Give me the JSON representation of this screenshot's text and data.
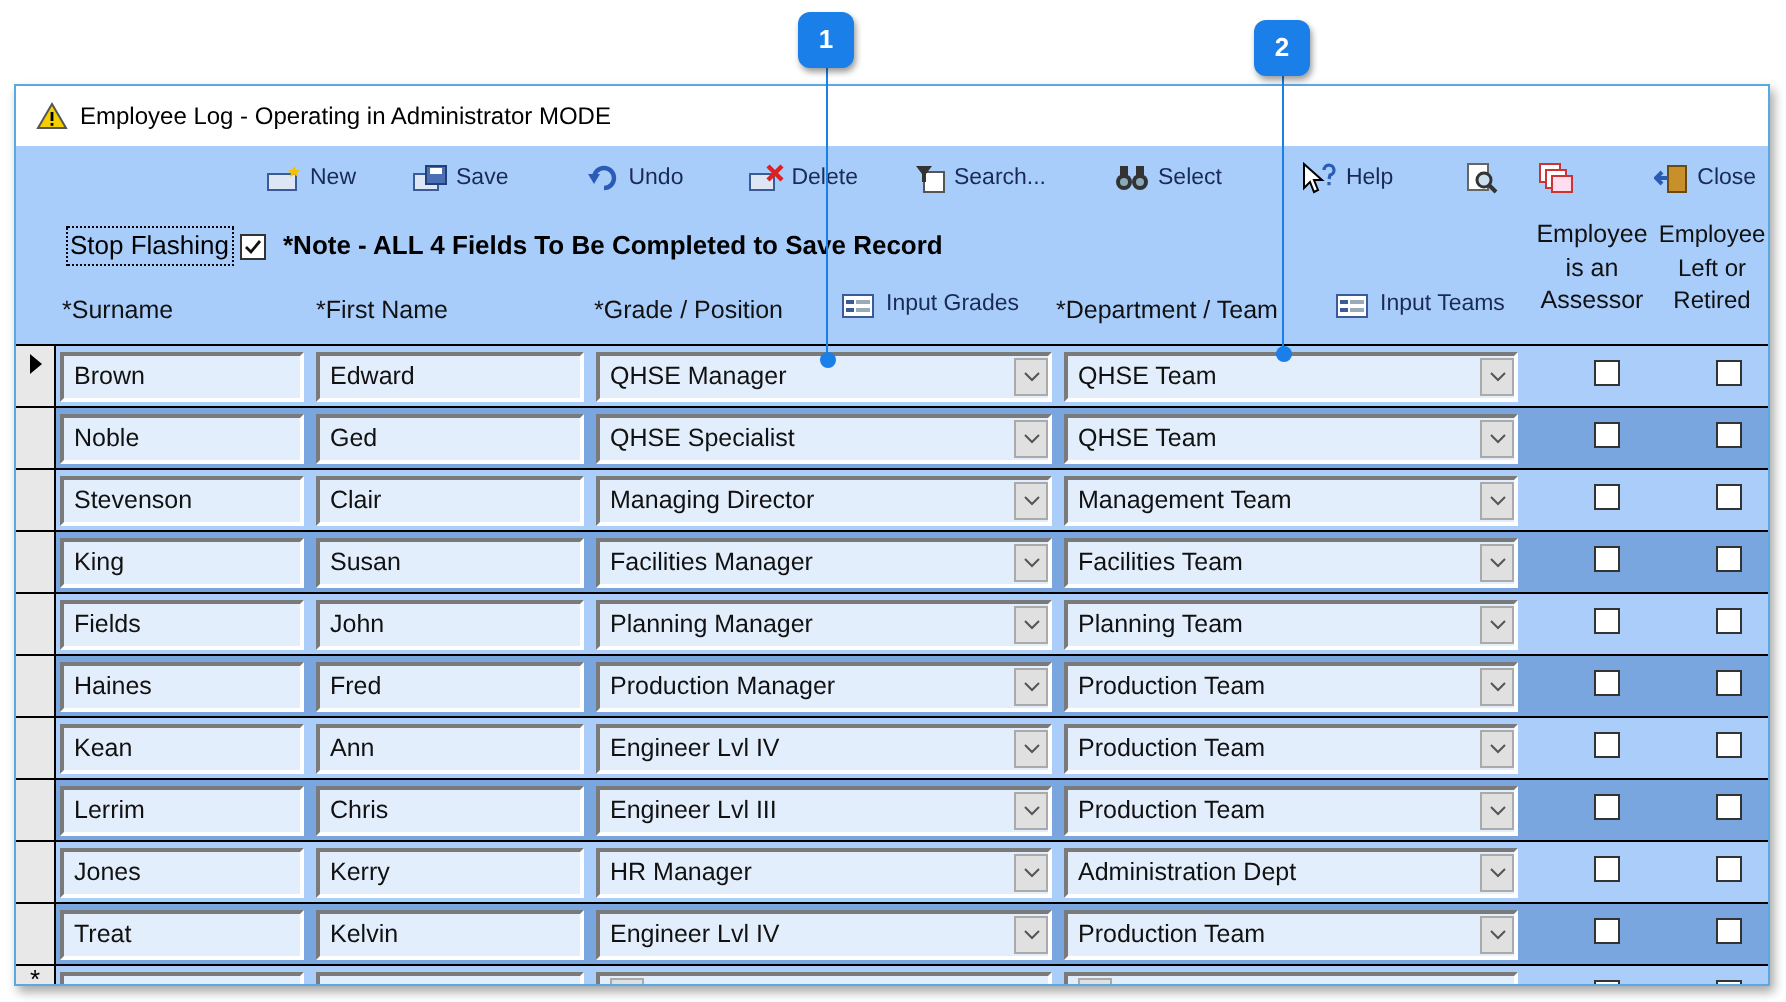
{
  "window": {
    "title": "Employee Log - Operating in Administrator MODE"
  },
  "callouts": [
    {
      "label": "1"
    },
    {
      "label": "2"
    }
  ],
  "toolbar": [
    {
      "kind": "new",
      "label": "New"
    },
    {
      "kind": "save",
      "label": "Save"
    },
    {
      "kind": "undo",
      "label": "Undo"
    },
    {
      "kind": "delete",
      "label": "Delete"
    },
    {
      "kind": "search",
      "label": "Search..."
    },
    {
      "kind": "select",
      "label": "Select"
    },
    {
      "kind": "help",
      "label": "Help"
    },
    {
      "kind": "preview"
    },
    {
      "kind": "report"
    },
    {
      "kind": "close",
      "label": "Close"
    }
  ],
  "stop_flashing": {
    "label": "Stop Flashing",
    "checked": true
  },
  "note": "*Note - ALL 4 Fields To Be Completed to Save Record",
  "columns": {
    "surname": "*Surname",
    "first_name": "*First Name",
    "grade": "*Grade / Position",
    "input_grades": "Input Grades",
    "department": "*Department / Team",
    "input_teams": "Input Teams",
    "assessor": "Employee is an Assessor",
    "left": "Employee Left or Retired"
  },
  "rows": [
    {
      "surname": "Brown",
      "first_name": "Edward",
      "grade": "QHSE Manager",
      "department": "QHSE Team",
      "assessor": false,
      "left": false,
      "selected": true
    },
    {
      "surname": "Noble",
      "first_name": "Ged",
      "grade": "QHSE Specialist",
      "department": "QHSE Team",
      "assessor": false,
      "left": false,
      "selected": false
    },
    {
      "surname": "Stevenson",
      "first_name": "Clair",
      "grade": "Managing Director",
      "department": "Management Team",
      "assessor": false,
      "left": false,
      "selected": false
    },
    {
      "surname": "King",
      "first_name": "Susan",
      "grade": "Facilities Manager",
      "department": "Facilities Team",
      "assessor": false,
      "left": false,
      "selected": false
    },
    {
      "surname": "Fields",
      "first_name": "John",
      "grade": "Planning Manager",
      "department": "Planning Team",
      "assessor": false,
      "left": false,
      "selected": false
    },
    {
      "surname": "Haines",
      "first_name": "Fred",
      "grade": "Production Manager",
      "department": "Production Team",
      "assessor": false,
      "left": false,
      "selected": false
    },
    {
      "surname": "Kean",
      "first_name": "Ann",
      "grade": "Engineer Lvl IV",
      "department": "Production Team",
      "assessor": false,
      "left": false,
      "selected": false
    },
    {
      "surname": "Lerrim",
      "first_name": "Chris",
      "grade": "Engineer Lvl III",
      "department": "Production Team",
      "assessor": false,
      "left": false,
      "selected": false
    },
    {
      "surname": "Jones",
      "first_name": "Kerry",
      "grade": "HR Manager",
      "department": "Administration Dept",
      "assessor": false,
      "left": false,
      "selected": false
    },
    {
      "surname": "Treat",
      "first_name": "Kelvin",
      "grade": "Engineer Lvl IV",
      "department": "Production Team",
      "assessor": false,
      "left": false,
      "selected": false
    }
  ],
  "new_row": {
    "marker": "*"
  }
}
